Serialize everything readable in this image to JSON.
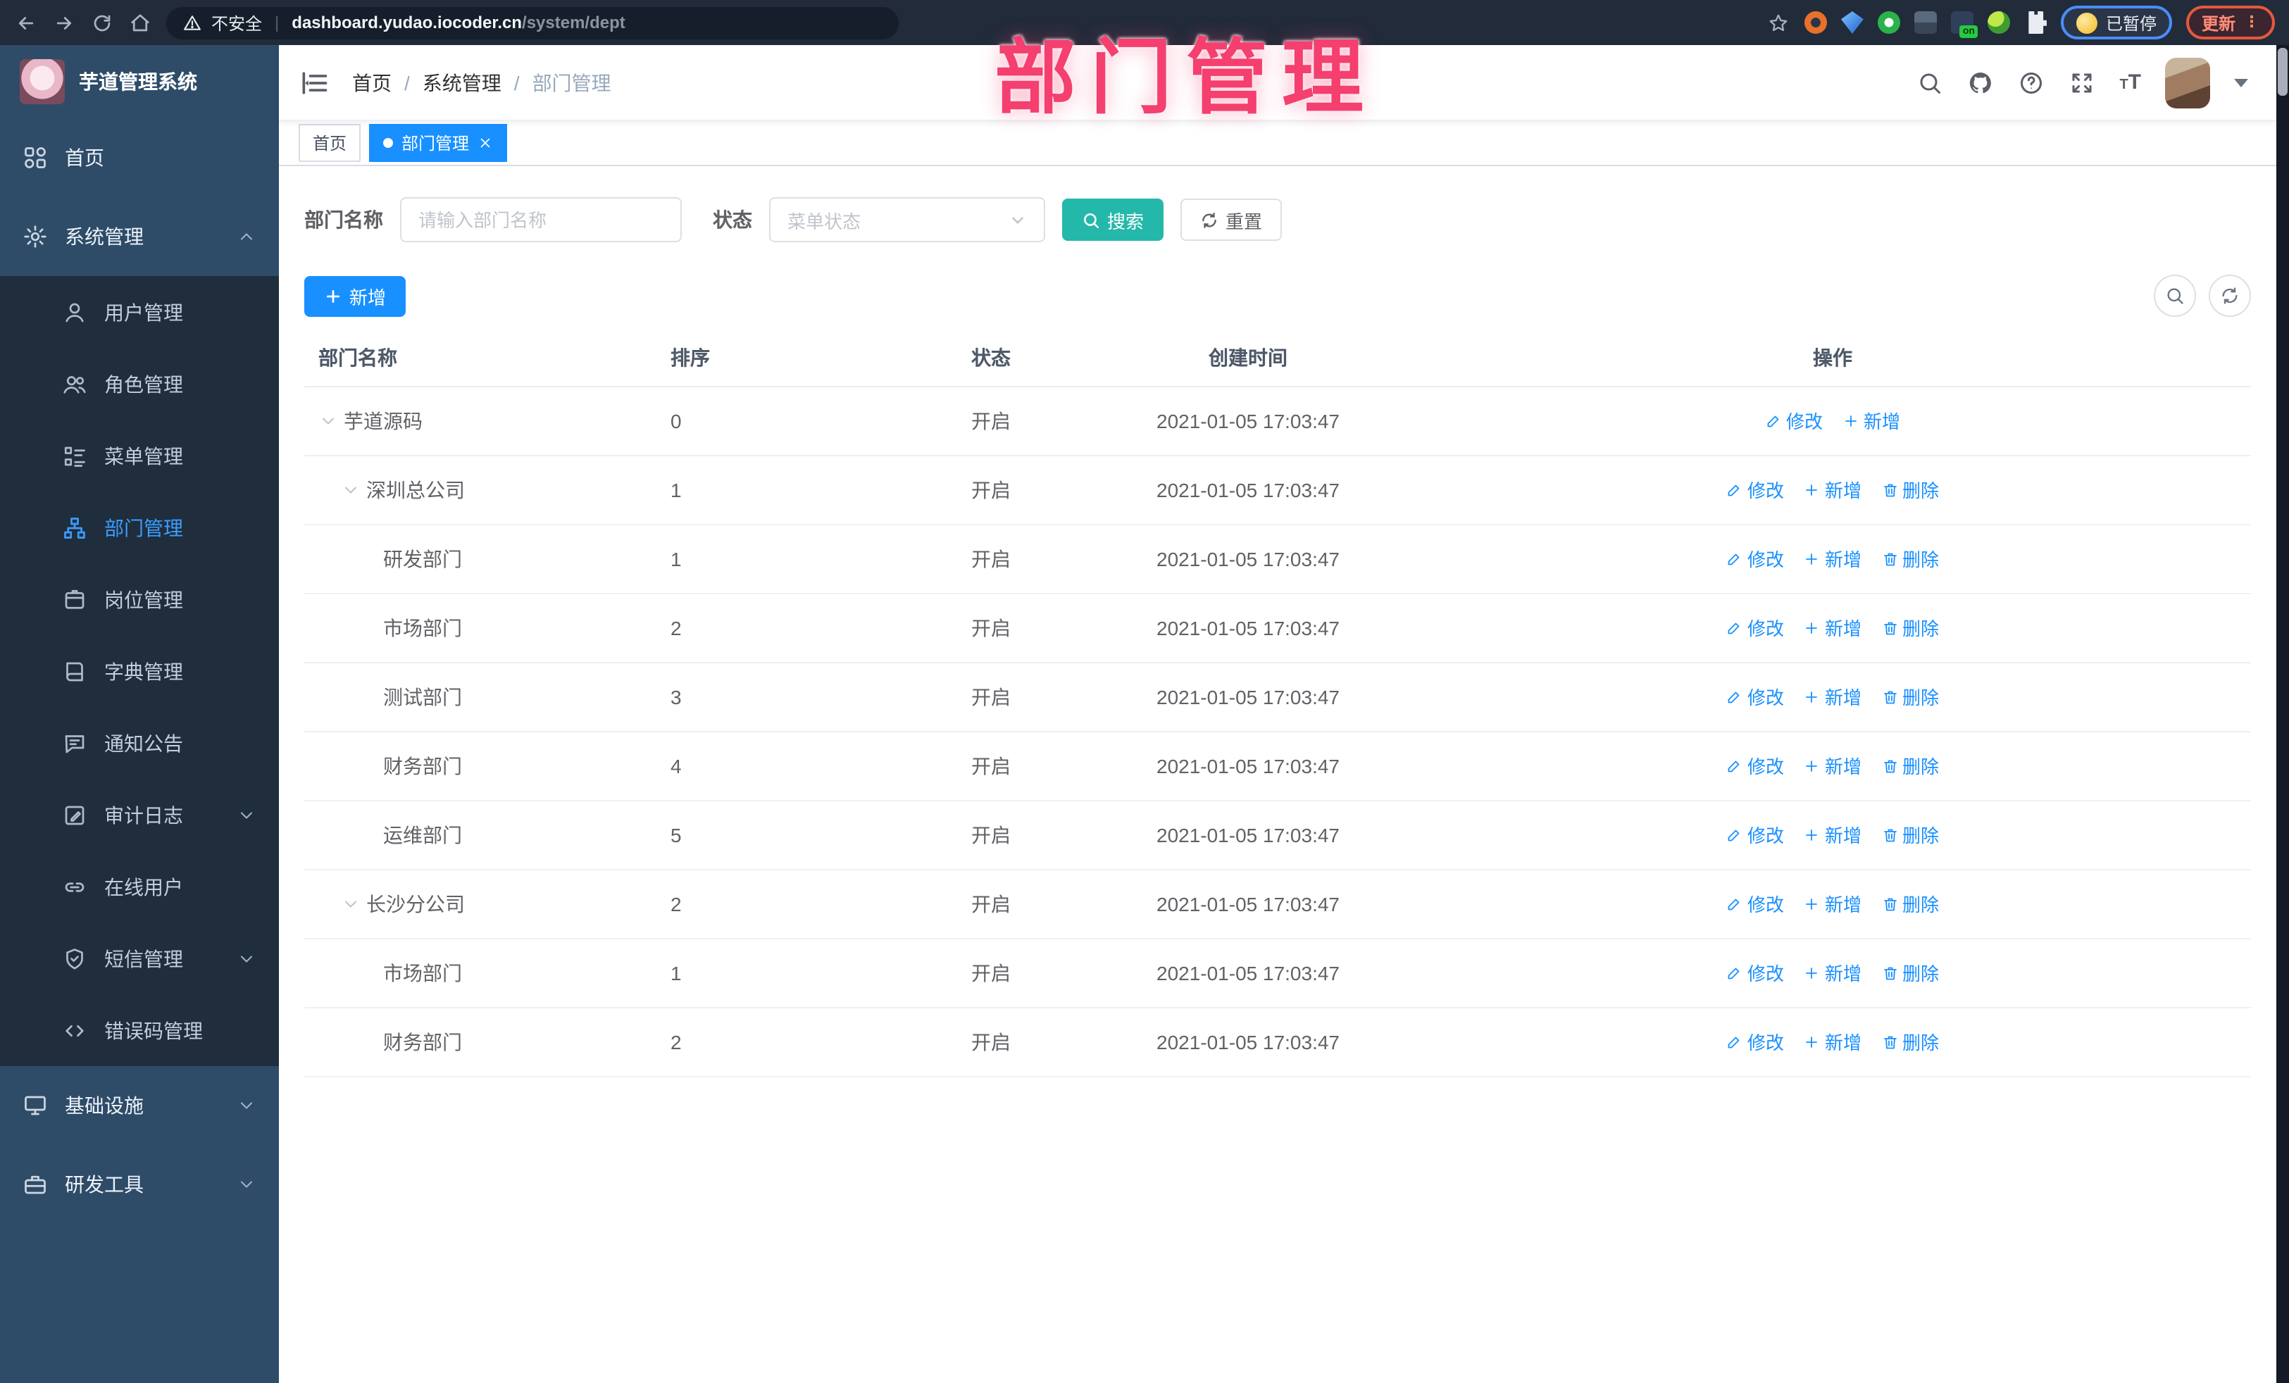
{
  "overlay": {
    "title": "部门管理"
  },
  "colors": {
    "primary": "#1890ff",
    "search_button": "#23b8aa",
    "annotation_pink": "#f43f6f",
    "sidebar_bg": "#2e4c68",
    "submenu_bg": "#1f2d3d",
    "active_tab_bg": "#1890ff"
  },
  "browser": {
    "security_label": "不安全",
    "url_host": "dashboard.yudao.iocoder.cn",
    "url_path": "/system/dept",
    "profile_status_label": "已暂停",
    "update_label": "更新"
  },
  "sidebar": {
    "app_title": "芋道管理系统",
    "menu": [
      {
        "label": "首页",
        "icon": "dashboard-icon",
        "kind": "root"
      },
      {
        "label": "系统管理",
        "icon": "gear-icon",
        "kind": "root",
        "chevron": "up"
      },
      {
        "label": "用户管理",
        "icon": "user-icon",
        "kind": "sub"
      },
      {
        "label": "角色管理",
        "icon": "users-icon",
        "kind": "sub"
      },
      {
        "label": "菜单管理",
        "icon": "menu-tree-icon",
        "kind": "sub"
      },
      {
        "label": "部门管理",
        "icon": "org-tree-icon",
        "kind": "sub",
        "active": true
      },
      {
        "label": "岗位管理",
        "icon": "badge-icon",
        "kind": "sub"
      },
      {
        "label": "字典管理",
        "icon": "book-icon",
        "kind": "sub"
      },
      {
        "label": "通知公告",
        "icon": "announcement-icon",
        "kind": "sub"
      },
      {
        "label": "审计日志",
        "icon": "audit-log-icon",
        "kind": "sub",
        "chevron": "down"
      },
      {
        "label": "在线用户",
        "icon": "online-user-icon",
        "kind": "sub"
      },
      {
        "label": "短信管理",
        "icon": "sms-shield-icon",
        "kind": "sub",
        "chevron": "down"
      },
      {
        "label": "错误码管理",
        "icon": "code-icon",
        "kind": "sub"
      },
      {
        "label": "基础设施",
        "icon": "monitor-icon",
        "kind": "root",
        "chevron": "down"
      },
      {
        "label": "研发工具",
        "icon": "toolbox-icon",
        "kind": "root",
        "chevron": "down"
      }
    ]
  },
  "header": {
    "breadcrumb": [
      "首页",
      "系统管理",
      "部门管理"
    ],
    "icons": [
      "search-icon",
      "github-icon",
      "help-icon",
      "fullscreen-icon",
      "font-size-icon"
    ]
  },
  "tabs": [
    {
      "label": "首页",
      "active": false
    },
    {
      "label": "部门管理",
      "active": true,
      "closable": true
    }
  ],
  "search": {
    "name_label": "部门名称",
    "name_placeholder": "请输入部门名称",
    "status_label": "状态",
    "status_placeholder": "菜单状态",
    "search_label": "搜索",
    "reset_label": "重置"
  },
  "toolbar": {
    "add_label": "新增"
  },
  "table": {
    "headers": [
      "部门名称",
      "排序",
      "状态",
      "创建时间",
      "操作"
    ],
    "action_labels": {
      "edit": "修改",
      "add": "新增",
      "delete": "删除"
    },
    "rows": [
      {
        "name": "芋道源码",
        "level": 0,
        "expandable": true,
        "sort": "0",
        "status": "开启",
        "created": "2021-01-05 17:03:47",
        "actions": [
          "edit",
          "add"
        ]
      },
      {
        "name": "深圳总公司",
        "level": 1,
        "expandable": true,
        "sort": "1",
        "status": "开启",
        "created": "2021-01-05 17:03:47",
        "actions": [
          "edit",
          "add",
          "delete"
        ]
      },
      {
        "name": "研发部门",
        "level": 2,
        "expandable": false,
        "sort": "1",
        "status": "开启",
        "created": "2021-01-05 17:03:47",
        "actions": [
          "edit",
          "add",
          "delete"
        ]
      },
      {
        "name": "市场部门",
        "level": 2,
        "expandable": false,
        "sort": "2",
        "status": "开启",
        "created": "2021-01-05 17:03:47",
        "actions": [
          "edit",
          "add",
          "delete"
        ]
      },
      {
        "name": "测试部门",
        "level": 2,
        "expandable": false,
        "sort": "3",
        "status": "开启",
        "created": "2021-01-05 17:03:47",
        "actions": [
          "edit",
          "add",
          "delete"
        ]
      },
      {
        "name": "财务部门",
        "level": 2,
        "expandable": false,
        "sort": "4",
        "status": "开启",
        "created": "2021-01-05 17:03:47",
        "actions": [
          "edit",
          "add",
          "delete"
        ]
      },
      {
        "name": "运维部门",
        "level": 2,
        "expandable": false,
        "sort": "5",
        "status": "开启",
        "created": "2021-01-05 17:03:47",
        "actions": [
          "edit",
          "add",
          "delete"
        ]
      },
      {
        "name": "长沙分公司",
        "level": 1,
        "expandable": true,
        "sort": "2",
        "status": "开启",
        "created": "2021-01-05 17:03:47",
        "actions": [
          "edit",
          "add",
          "delete"
        ]
      },
      {
        "name": "市场部门",
        "level": 2,
        "expandable": false,
        "sort": "1",
        "status": "开启",
        "created": "2021-01-05 17:03:47",
        "actions": [
          "edit",
          "add",
          "delete"
        ]
      },
      {
        "name": "财务部门",
        "level": 2,
        "expandable": false,
        "sort": "2",
        "status": "开启",
        "created": "2021-01-05 17:03:47",
        "actions": [
          "edit",
          "add",
          "delete"
        ]
      }
    ]
  }
}
